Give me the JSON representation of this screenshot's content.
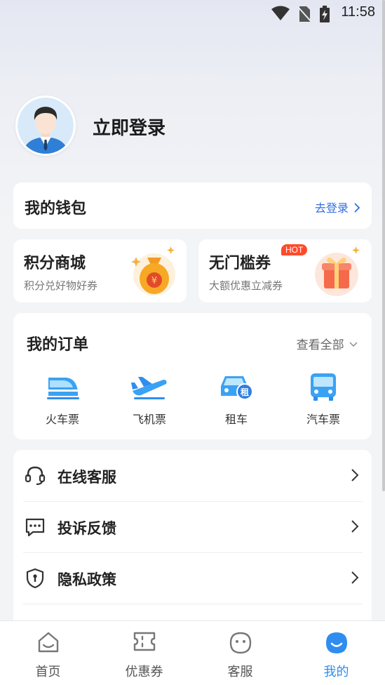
{
  "status_bar": {
    "time": "11:58"
  },
  "profile": {
    "login_label": "立即登录"
  },
  "wallet": {
    "title": "我的钱包",
    "link_label": "去登录"
  },
  "promos": [
    {
      "title": "积分商城",
      "subtitle": "积分兑好物好券"
    },
    {
      "title": "无门槛券",
      "subtitle": "大额优惠立减券",
      "badge": "HOT"
    }
  ],
  "orders": {
    "title": "我的订单",
    "view_all": "查看全部",
    "items": [
      {
        "label": "火车票",
        "icon": "train-icon"
      },
      {
        "label": "飞机票",
        "icon": "plane-icon"
      },
      {
        "label": "租车",
        "icon": "car-rental-icon",
        "icon_text": "租"
      },
      {
        "label": "汽车票",
        "icon": "bus-icon"
      }
    ]
  },
  "menu": [
    {
      "label": "在线客服",
      "icon": "headset-icon"
    },
    {
      "label": "投诉反馈",
      "icon": "feedback-icon"
    },
    {
      "label": "隐私政策",
      "icon": "shield-icon"
    }
  ],
  "tabs": [
    {
      "label": "首页",
      "icon": "home-icon"
    },
    {
      "label": "优惠券",
      "icon": "ticket-icon"
    },
    {
      "label": "客服",
      "icon": "service-face-icon"
    },
    {
      "label": "我的",
      "icon": "profile-icon",
      "active": true
    }
  ],
  "colors": {
    "accent": "#2f8df0",
    "link": "#2f6fe4",
    "hot": "#ff4a2b"
  }
}
